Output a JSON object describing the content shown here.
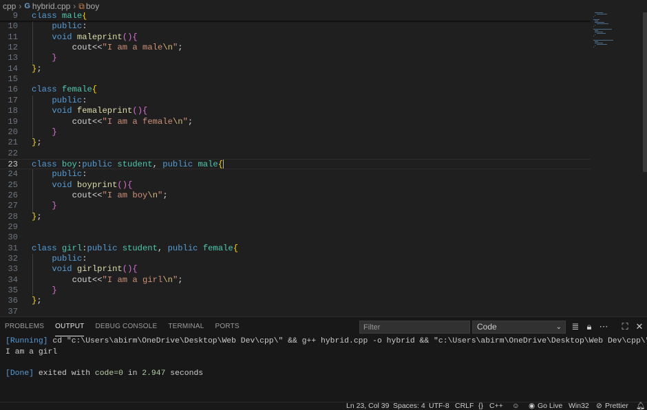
{
  "breadcrumb": {
    "items": [
      {
        "label": "cpp"
      },
      {
        "label": "hybrid.cpp",
        "icon": "cpp-file-icon"
      },
      {
        "label": "boy",
        "icon": "class-symbol-icon"
      }
    ]
  },
  "editor": {
    "file": "hybrid.cpp",
    "cursor_line": "23",
    "lines": [
      {
        "n": "9",
        "code": "class male{"
      },
      {
        "n": "10",
        "code": "    public:"
      },
      {
        "n": "11",
        "code": "    void maleprint(){"
      },
      {
        "n": "12",
        "code": "        cout<<\"I am a male\\n\";"
      },
      {
        "n": "13",
        "code": "    }"
      },
      {
        "n": "14",
        "code": "};"
      },
      {
        "n": "15",
        "code": ""
      },
      {
        "n": "16",
        "code": "class female{"
      },
      {
        "n": "17",
        "code": "    public:"
      },
      {
        "n": "18",
        "code": "    void femaleprint(){"
      },
      {
        "n": "19",
        "code": "        cout<<\"I am a female\\n\";"
      },
      {
        "n": "20",
        "code": "    }"
      },
      {
        "n": "21",
        "code": "};"
      },
      {
        "n": "22",
        "code": ""
      },
      {
        "n": "23",
        "code": "class boy:public student, public male{"
      },
      {
        "n": "24",
        "code": "    public:"
      },
      {
        "n": "25",
        "code": "    void boyprint(){"
      },
      {
        "n": "26",
        "code": "        cout<<\"I am boy\\n\";"
      },
      {
        "n": "27",
        "code": "    }"
      },
      {
        "n": "28",
        "code": "};"
      },
      {
        "n": "29",
        "code": ""
      },
      {
        "n": "30",
        "code": ""
      },
      {
        "n": "31",
        "code": "class girl:public student, public female{"
      },
      {
        "n": "32",
        "code": "    public:"
      },
      {
        "n": "33",
        "code": "    void girlprint(){"
      },
      {
        "n": "34",
        "code": "        cout<<\"I am a girl\\n\";"
      },
      {
        "n": "35",
        "code": "    }"
      },
      {
        "n": "36",
        "code": "};"
      },
      {
        "n": "37",
        "code": ""
      }
    ]
  },
  "panel": {
    "tabs": [
      {
        "label": "PROBLEMS",
        "active": false
      },
      {
        "label": "OUTPUT",
        "active": true
      },
      {
        "label": "DEBUG CONSOLE",
        "active": false
      },
      {
        "label": "TERMINAL",
        "active": false
      },
      {
        "label": "PORTS",
        "active": false
      }
    ],
    "filter_placeholder": "Filter",
    "channel": "Code",
    "output": {
      "running_tag": "[Running]",
      "command": " cd \"c:\\Users\\abirm\\OneDrive\\Desktop\\Web Dev\\cpp\\\" && g++ hybrid.cpp -o hybrid && \"c:\\Users\\abirm\\OneDrive\\Desktop\\Web Dev\\cpp\\\"hybrid",
      "program_output": "I am a girl",
      "done_tag": "[Done]",
      "done_text_1": " exited with ",
      "done_code": "code=0",
      "done_text_2": " in ",
      "done_time": "2.947",
      "done_text_3": " seconds"
    }
  },
  "statusbar": {
    "position": "Ln 23, Col 39",
    "spaces": "Spaces: 4",
    "encoding": "UTF-8",
    "eol": "CRLF",
    "language": "C++",
    "golive": "Go Live",
    "platform": "Win32",
    "prettier": "Prettier"
  },
  "colors": {
    "keyword": "#569cd6",
    "class": "#4ec9b0",
    "function": "#dcdcaa",
    "string": "#ce9178",
    "bracket_1": "#ffd700",
    "bracket_2": "#da70d6",
    "editor_bg": "#1f1f1f",
    "panel_bg": "#181818"
  }
}
